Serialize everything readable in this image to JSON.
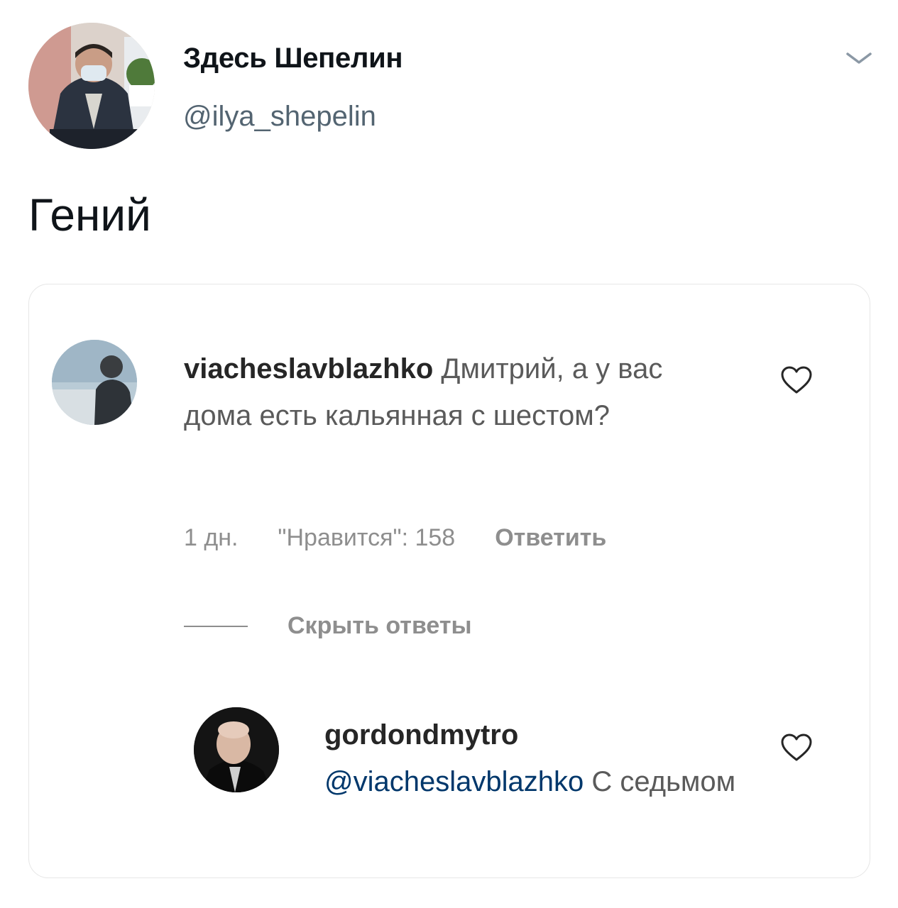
{
  "tweet": {
    "author": {
      "display_name": "Здесь Шепелин",
      "handle": "@ilya_shepelin"
    },
    "text": "Гений"
  },
  "embed": {
    "comment": {
      "username": "viacheslavblazhko",
      "text": " Дмитрий, а у вас дома есть кальянная с шестом?",
      "time": "1 дн.",
      "likes": "\"Нравится\": 158",
      "reply_label": "Ответить"
    },
    "hide_replies_label": "Скрыть ответы",
    "reply": {
      "username": "gordondmytro",
      "mention": "@viacheslavblazhko",
      "text": " С седьмом"
    }
  },
  "icons": {
    "menu": "chevron-down-icon",
    "like": "heart-icon"
  },
  "colors": {
    "text_primary": "#0f1419",
    "text_secondary": "#536471",
    "mention": "#00376b",
    "meta_gray": "#8e8e8e",
    "card_border": "#e6e6e6"
  }
}
